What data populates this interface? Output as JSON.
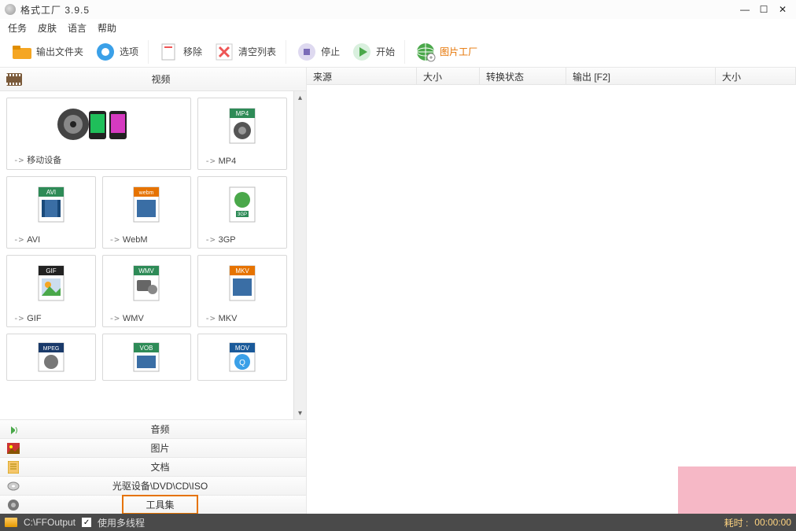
{
  "window": {
    "title": "格式工厂 3.9.5"
  },
  "menu": {
    "items": [
      "任务",
      "皮肤",
      "语言",
      "帮助"
    ]
  },
  "toolbar": {
    "output_folder": "输出文件夹",
    "options": "选项",
    "remove": "移除",
    "clear_list": "清空列表",
    "stop": "停止",
    "start": "开始",
    "pic_factory": "图片工厂"
  },
  "left": {
    "video_label": "视频",
    "tiles": [
      {
        "label": "移动设备"
      },
      {
        "label": "MP4"
      },
      {
        "label": "AVI"
      },
      {
        "label": "WebM"
      },
      {
        "label": "3GP"
      },
      {
        "label": "GIF"
      },
      {
        "label": "WMV"
      },
      {
        "label": "MKV"
      },
      {
        "label": "MPEG"
      },
      {
        "label": "VOB"
      },
      {
        "label": "MOV"
      }
    ],
    "categories": {
      "audio": "音频",
      "image": "图片",
      "document": "文档",
      "disc": "光驱设备\\DVD\\CD\\ISO",
      "toolset": "工具集"
    }
  },
  "right": {
    "cols": {
      "source": "来源",
      "size1": "大小",
      "status": "转换状态",
      "output": "输出 [F2]",
      "size2": "大小"
    }
  },
  "status": {
    "path": "C:\\FFOutput",
    "multithread": "使用多线程",
    "elapsed_label": "耗时 :",
    "elapsed_value": "00:00:00"
  }
}
